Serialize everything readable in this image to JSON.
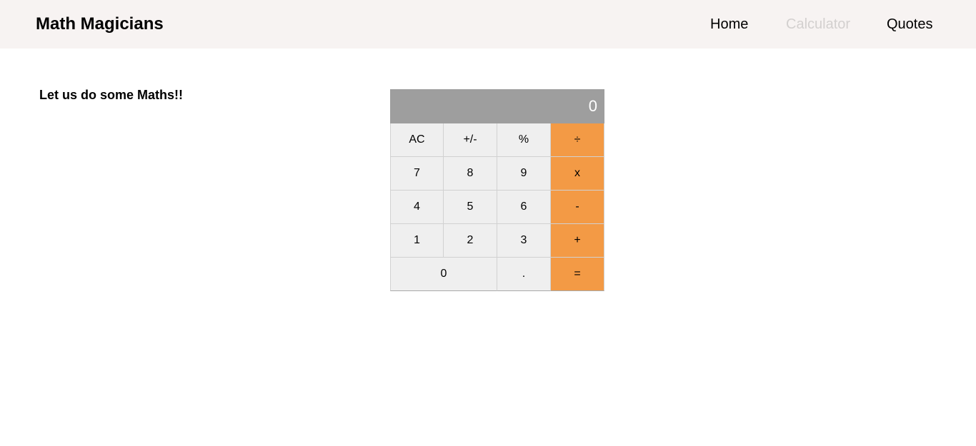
{
  "header": {
    "brand": "Math Magicians",
    "nav": [
      {
        "label": "Home"
      },
      {
        "label": "Calculator"
      },
      {
        "label": "Quotes"
      }
    ],
    "colors": {
      "background": "#f7f3f2",
      "active_link": "#d3d0cf"
    }
  },
  "main": {
    "intro": "Let us do some Maths!!"
  },
  "calculator": {
    "display": "0",
    "colors": {
      "display": "#9e9e9e",
      "key": "#efefef",
      "operator": "#f39a45"
    },
    "keys": {
      "ac": "AC",
      "sign": "+/-",
      "percent": "%",
      "divide": "÷",
      "seven": "7",
      "eight": "8",
      "nine": "9",
      "multiply": "x",
      "four": "4",
      "five": "5",
      "six": "6",
      "subtract": "-",
      "one": "1",
      "two": "2",
      "three": "3",
      "add": "+",
      "zero": "0",
      "decimal": ".",
      "equals": "="
    }
  }
}
